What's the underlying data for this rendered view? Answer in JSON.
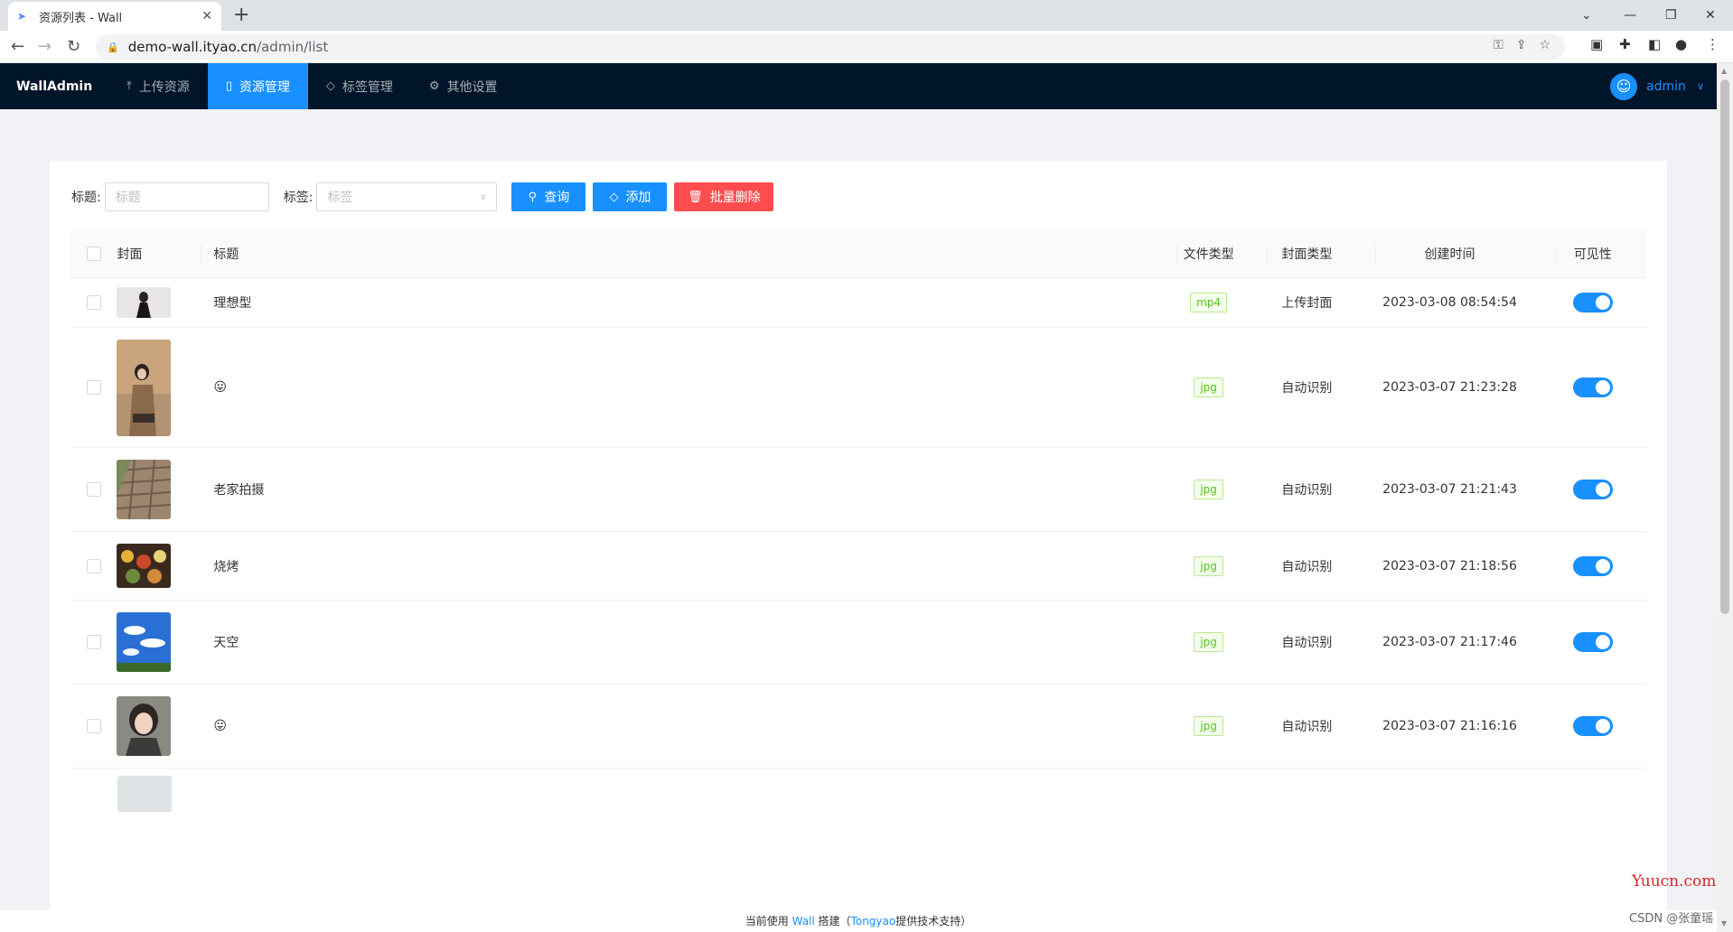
{
  "browser": {
    "tab_title": "资源列表 - Wall",
    "close_glyph": "✕",
    "new_tab_glyph": "+",
    "url_host": "demo-wall.ityao.cn",
    "url_path": "/admin/list"
  },
  "app": {
    "brand": "WallAdmin",
    "menu": [
      {
        "label": "上传资源",
        "icon": "upload-icon"
      },
      {
        "label": "资源管理",
        "icon": "file-icon",
        "active": true
      },
      {
        "label": "标签管理",
        "icon": "tag-icon"
      },
      {
        "label": "其他设置",
        "icon": "gear-icon"
      }
    ],
    "user": "admin",
    "accent": "#1890ff",
    "header_bg": "#001529"
  },
  "filters": {
    "title_label": "标题:",
    "title_placeholder": "标题",
    "tag_label": "标签:",
    "tag_placeholder": "标签",
    "search_btn": "查询",
    "add_btn": "添加",
    "batch_delete_btn": "批量删除"
  },
  "table": {
    "headers": {
      "cover": "封面",
      "title": "标题",
      "file_type": "文件类型",
      "cover_type": "封面类型",
      "created": "创建时间",
      "visible": "可见性"
    },
    "rows": [
      {
        "title": "理想型",
        "file_type": "mp4",
        "cover_type": "上传封面",
        "created": "2023-03-08 08:54:54",
        "visible": true
      },
      {
        "title": "😛",
        "file_type": "jpg",
        "cover_type": "自动识别",
        "created": "2023-03-07 21:23:28",
        "visible": true
      },
      {
        "title": "老家拍摄",
        "file_type": "jpg",
        "cover_type": "自动识别",
        "created": "2023-03-07 21:21:43",
        "visible": true
      },
      {
        "title": "烧烤",
        "file_type": "jpg",
        "cover_type": "自动识别",
        "created": "2023-03-07 21:18:56",
        "visible": true
      },
      {
        "title": "天空",
        "file_type": "jpg",
        "cover_type": "自动识别",
        "created": "2023-03-07 21:17:46",
        "visible": true
      },
      {
        "title": "😛",
        "file_type": "jpg",
        "cover_type": "自动识别",
        "created": "2023-03-07 21:16:16",
        "visible": true
      }
    ]
  },
  "footer": {
    "prefix": "当前使用",
    "wall": "Wall",
    "mid": "搭建（",
    "tongyao": "Tongyao",
    "suffix": "提供技术支持）"
  },
  "watermark": {
    "site": "Yuucn.com",
    "author": "CSDN @张童瑶"
  }
}
